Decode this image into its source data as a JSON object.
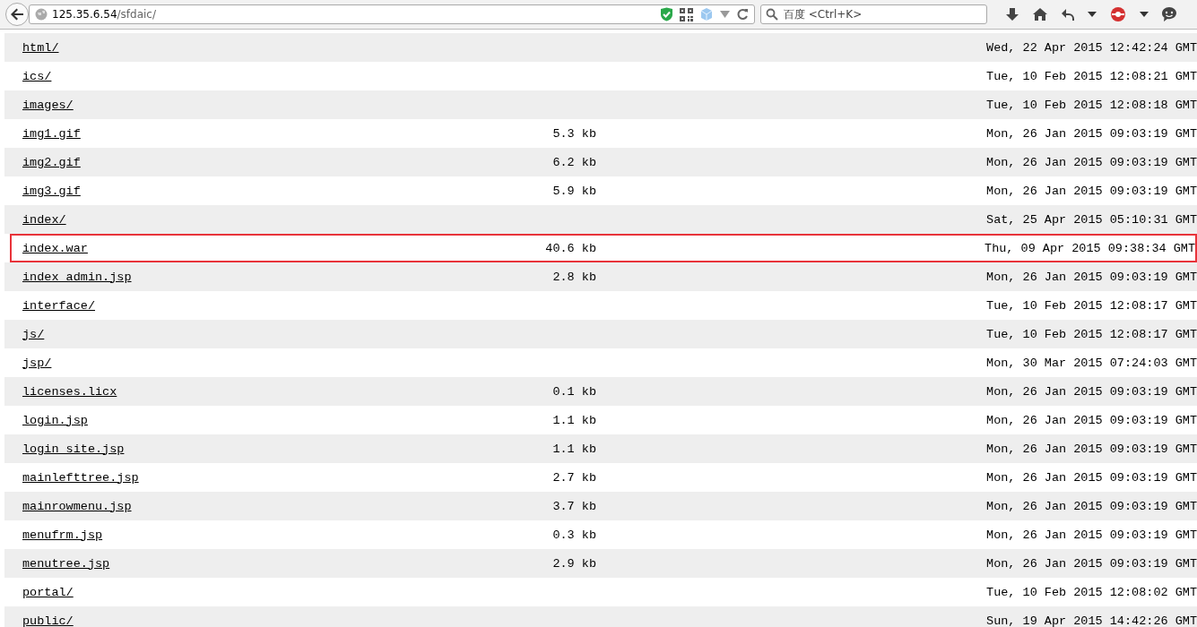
{
  "browser": {
    "address_host": "125.35.6.54",
    "address_path": "/sfdaic/",
    "search_placeholder": "百度 <Ctrl+K>"
  },
  "listing": [
    {
      "name": "html/",
      "modified": "Wed, 22 Apr 2015 12:42:24 GMT",
      "highlighted": false
    },
    {
      "name": "ics/",
      "modified": "Tue, 10 Feb 2015 12:08:21 GMT",
      "highlighted": false
    },
    {
      "name": "images/",
      "modified": "Tue, 10 Feb 2015 12:08:18 GMT",
      "highlighted": false
    },
    {
      "name": "img1.gif",
      "size": "5.3 kb",
      "modified": "Mon, 26 Jan 2015 09:03:19 GMT",
      "highlighted": false
    },
    {
      "name": "img2.gif",
      "size": "6.2 kb",
      "modified": "Mon, 26 Jan 2015 09:03:19 GMT",
      "highlighted": false
    },
    {
      "name": "img3.gif",
      "size": "5.9 kb",
      "modified": "Mon, 26 Jan 2015 09:03:19 GMT",
      "highlighted": false
    },
    {
      "name": "index/",
      "modified": "Sat, 25 Apr 2015 05:10:31 GMT",
      "highlighted": false
    },
    {
      "name": "index.war",
      "size": "40.6 kb",
      "modified": "Thu, 09 Apr 2015 09:38:34 GMT",
      "highlighted": true
    },
    {
      "name": "index_admin.jsp",
      "size": "2.8 kb",
      "modified": "Mon, 26 Jan 2015 09:03:19 GMT",
      "highlighted": false
    },
    {
      "name": "interface/",
      "modified": "Tue, 10 Feb 2015 12:08:17 GMT",
      "highlighted": false
    },
    {
      "name": "js/",
      "modified": "Tue, 10 Feb 2015 12:08:17 GMT",
      "highlighted": false
    },
    {
      "name": "jsp/",
      "modified": "Mon, 30 Mar 2015 07:24:03 GMT",
      "highlighted": false
    },
    {
      "name": "licenses.licx",
      "size": "0.1 kb",
      "modified": "Mon, 26 Jan 2015 09:03:19 GMT",
      "highlighted": false
    },
    {
      "name": "login.jsp",
      "size": "1.1 kb",
      "modified": "Mon, 26 Jan 2015 09:03:19 GMT",
      "highlighted": false
    },
    {
      "name": "login_site.jsp",
      "size": "1.1 kb",
      "modified": "Mon, 26 Jan 2015 09:03:19 GMT",
      "highlighted": false
    },
    {
      "name": "mainlefttree.jsp",
      "size": "2.7 kb",
      "modified": "Mon, 26 Jan 2015 09:03:19 GMT",
      "highlighted": false
    },
    {
      "name": "mainrowmenu.jsp",
      "size": "3.7 kb",
      "modified": "Mon, 26 Jan 2015 09:03:19 GMT",
      "highlighted": false
    },
    {
      "name": "menufrm.jsp",
      "size": "0.3 kb",
      "modified": "Mon, 26 Jan 2015 09:03:19 GMT",
      "highlighted": false
    },
    {
      "name": "menutree.jsp",
      "size": "2.9 kb",
      "modified": "Mon, 26 Jan 2015 09:03:19 GMT",
      "highlighted": false
    },
    {
      "name": "portal/",
      "modified": "Tue, 10 Feb 2015 12:08:02 GMT",
      "highlighted": false
    },
    {
      "name": "public/",
      "modified": "Sun, 19 Apr 2015 14:42:26 GMT",
      "highlighted": false
    }
  ]
}
